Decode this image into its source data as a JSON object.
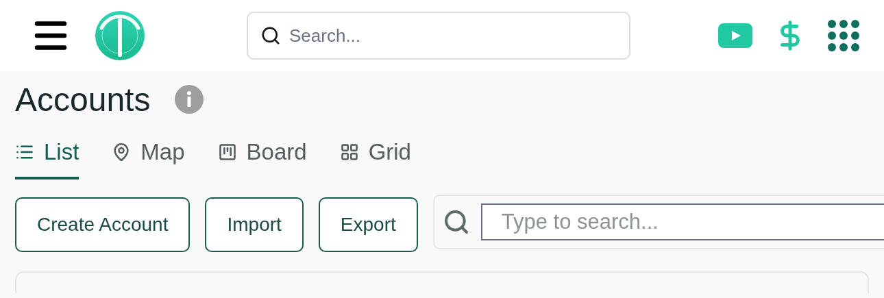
{
  "header": {
    "search": {
      "placeholder": "Search..."
    }
  },
  "page": {
    "title": "Accounts"
  },
  "tabs": [
    {
      "label": "List",
      "kind": "list",
      "selected": true
    },
    {
      "label": "Map",
      "kind": "map",
      "selected": false
    },
    {
      "label": "Board",
      "kind": "board",
      "selected": false
    },
    {
      "label": "Grid",
      "kind": "grid",
      "selected": false
    }
  ],
  "actions": [
    "Create Account",
    "Import",
    "Export"
  ],
  "filter": {
    "placeholder": "Type to search..."
  }
}
